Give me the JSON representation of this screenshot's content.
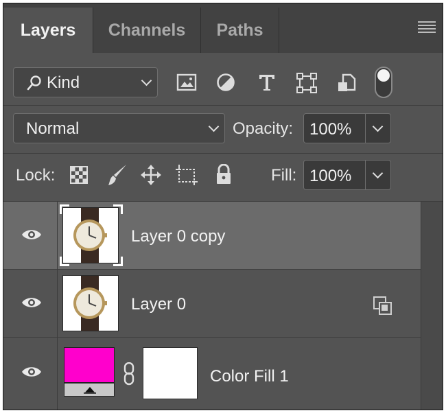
{
  "tabs": [
    {
      "label": "Layers"
    },
    {
      "label": "Channels"
    },
    {
      "label": "Paths"
    }
  ],
  "filter": {
    "kind_label": "Kind"
  },
  "blend": {
    "mode": "Normal",
    "opacity_label": "Opacity:",
    "opacity_value": "100%"
  },
  "lock": {
    "label": "Lock:",
    "fill_label": "Fill:",
    "fill_value": "100%"
  },
  "layers": [
    {
      "name": "Layer 0 copy",
      "selected": true
    },
    {
      "name": "Layer 0",
      "selected": false
    },
    {
      "name": "Color Fill 1",
      "selected": false,
      "fill_color": "#ff00cc"
    }
  ],
  "colors": {
    "panel_bg": "#535353",
    "tab_bar_bg": "#424242",
    "selected_row": "#6b6b6b",
    "fill_swatch": "#ff00cc"
  }
}
